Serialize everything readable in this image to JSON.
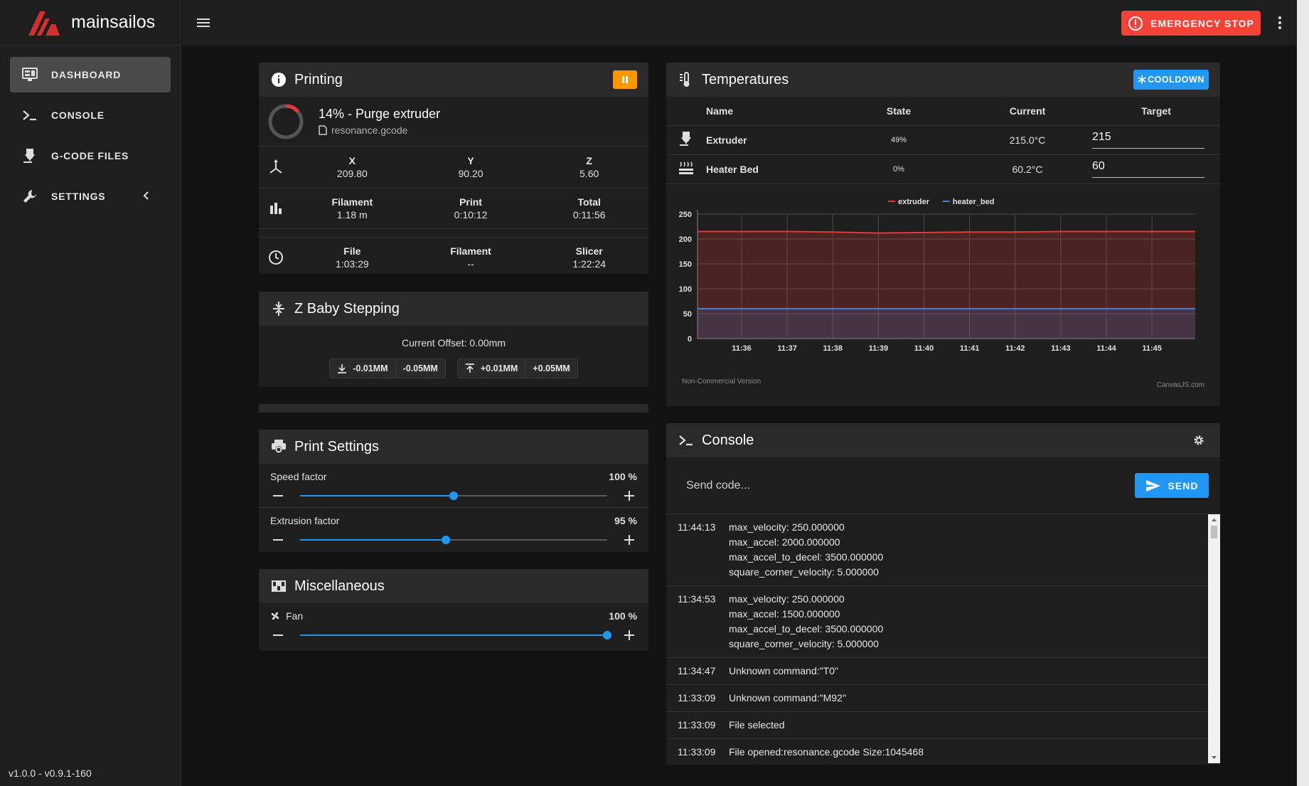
{
  "app": {
    "name": "mainsailos",
    "version": "v1.0.0 - v0.9.1-160"
  },
  "nav": [
    {
      "label": "DASHBOARD",
      "icon": "monitor-dashboard-icon",
      "active": true
    },
    {
      "label": "CONSOLE",
      "icon": "console-icon",
      "active": false
    },
    {
      "label": "G-CODE FILES",
      "icon": "printer-3d-nozzle-icon",
      "active": false
    },
    {
      "label": "SETTINGS",
      "icon": "wrench-icon",
      "active": false
    }
  ],
  "topbar": {
    "emergency_stop_label": "EMERGENCY STOP"
  },
  "printing": {
    "title": "Printing",
    "progress": 0.14,
    "job_title": "14% - Purge extruder",
    "filename": "resonance.gcode",
    "position": [
      {
        "label": "X",
        "value": "209.80"
      },
      {
        "label": "Y",
        "value": "90.20"
      },
      {
        "label": "Z",
        "value": "5.60"
      }
    ],
    "stats": [
      {
        "label": "Filament",
        "value": "1.18 m"
      },
      {
        "label": "Print",
        "value": "0:10:12"
      },
      {
        "label": "Total",
        "value": "0:11:56"
      }
    ],
    "estimates": [
      {
        "label": "File",
        "value": "1:03:29"
      },
      {
        "label": "Filament",
        "value": "--"
      },
      {
        "label": "Slicer",
        "value": "1:22:24"
      }
    ]
  },
  "baby_stepping": {
    "title": "Z Baby Stepping",
    "offset_text": "Current Offset: 0.00mm",
    "down_buttons": [
      "-0.01MM",
      "-0.05MM"
    ],
    "up_buttons": [
      "+0.01MM",
      "+0.05MM"
    ]
  },
  "print_settings": {
    "title": "Print Settings",
    "speed": {
      "label": "Speed factor",
      "value_text": "100 %",
      "fraction": 0.5
    },
    "extrusion": {
      "label": "Extrusion factor",
      "value_text": "95 %",
      "fraction": 0.475
    }
  },
  "misc": {
    "title": "Miscellaneous",
    "fan": {
      "label": "Fan",
      "value_text": "100 %",
      "fraction": 1.0
    }
  },
  "temperatures": {
    "title": "Temperatures",
    "cooldown_label": "COOLDOWN",
    "columns": [
      "Name",
      "State",
      "Current",
      "Target"
    ],
    "rows": [
      {
        "name": "Extruder",
        "state": "49%",
        "current": "215.0°C",
        "target": "215"
      },
      {
        "name": "Heater Bed",
        "state": "0%",
        "current": "60.2°C",
        "target": "60"
      }
    ]
  },
  "chart_data": {
    "type": "line",
    "x": [
      "11:35:20",
      "11:36",
      "11:37",
      "11:38",
      "11:38:30",
      "11:39",
      "11:40",
      "11:41",
      "11:42",
      "11:43",
      "11:44",
      "11:45"
    ],
    "x_ticks": [
      "11:36",
      "11:37",
      "11:38",
      "11:39",
      "11:40",
      "11:41",
      "11:42",
      "11:43",
      "11:44",
      "11:45"
    ],
    "series": [
      {
        "name": "extruder",
        "color": "#e53935",
        "values": [
          215,
          215,
          215,
          214,
          212,
          213,
          214,
          214,
          215,
          215,
          215,
          215
        ]
      },
      {
        "name": "heater_bed",
        "color": "#3f7fe0",
        "values": [
          60,
          60,
          60,
          60,
          60,
          60,
          60,
          60,
          60,
          60,
          60,
          60
        ]
      }
    ],
    "ylim": [
      0,
      250
    ],
    "y_ticks": [
      0,
      50,
      100,
      150,
      200,
      250
    ],
    "grid": true,
    "legend": "top-center",
    "watermark_left": "Non-Commercial Version",
    "watermark_right": "CanvasJS.com"
  },
  "console": {
    "title": "Console",
    "placeholder": "Send code...",
    "send_label": "SEND",
    "entries": [
      {
        "time": "11:44:13",
        "message": "max_velocity: 250.000000\nmax_accel: 2000.000000\nmax_accel_to_decel: 3500.000000\nsquare_corner_velocity: 5.000000"
      },
      {
        "time": "11:34:53",
        "message": "max_velocity: 250.000000\nmax_accel: 1500.000000\nmax_accel_to_decel: 3500.000000\nsquare_corner_velocity: 5.000000"
      },
      {
        "time": "11:34:47",
        "message": "Unknown command:\"T0\""
      },
      {
        "time": "11:33:09",
        "message": "Unknown command:\"M92\""
      },
      {
        "time": "11:33:09",
        "message": "File selected"
      },
      {
        "time": "11:33:09",
        "message": "File opened:resonance.gcode Size:1045468"
      }
    ]
  }
}
